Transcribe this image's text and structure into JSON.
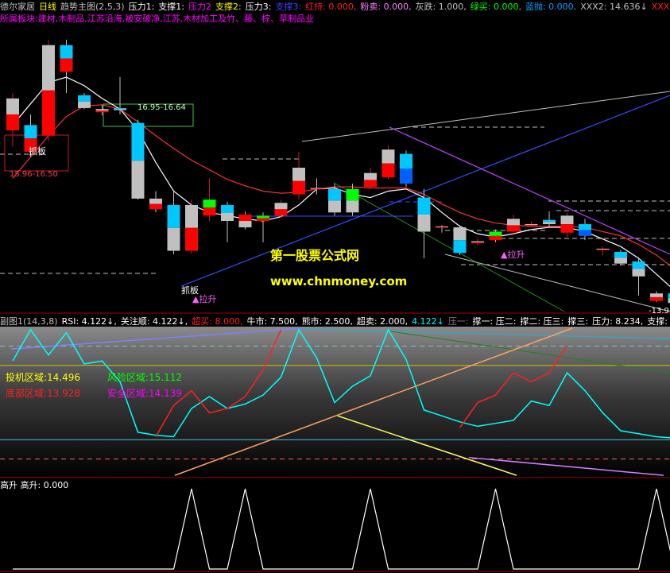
{
  "header_main": [
    {
      "text": "德尔家居",
      "color": "#c0c0c0"
    },
    {
      "text": "日线",
      "color": "#ffff00"
    },
    {
      "text": "趋势主图(2,5,3)",
      "color": "#c0c0c0"
    },
    {
      "text": "压力1:",
      "color": "#ffffff"
    },
    {
      "text": "支撑1:",
      "color": "#ffffff"
    },
    {
      "text": "压力2",
      "color": "#ff00ff"
    },
    {
      "text": "支撑2:",
      "color": "#ffff00"
    },
    {
      "text": "压力3:",
      "color": "#ffffff"
    },
    {
      "text": "支撑3:",
      "color": "#4040ff"
    },
    {
      "text": "红持: 0.000,",
      "color": "#ff2020"
    },
    {
      "text": "粉卖: 0.000,",
      "color": "#ff80ff"
    },
    {
      "text": "灰跌: 1.000,",
      "color": "#c0c0c0"
    },
    {
      "text": "绿买: 0.000,",
      "color": "#00ff00"
    },
    {
      "text": "蓝抛: 0.000,",
      "color": "#00a0ff"
    },
    {
      "text": "XXX2: 14.636↓",
      "color": "#c0c0c0"
    },
    {
      "text": "XXX3: 14.595↑",
      "color": "#ff2020"
    }
  ],
  "sector_line": {
    "text": "所属板块:建材,木制品,江苏沿海,被安破净,江苏,木材加工及竹、藤、棕、草制品业",
    "color": "#ff00ff"
  },
  "header_sub": [
    {
      "text": "副图1(14,3,8)",
      "color": "#c0c0c0"
    },
    {
      "text": "RSI: 4.122↓,",
      "color": "#ffffff"
    },
    {
      "text": "关注顺: 4.122↓,",
      "color": "#ffffff"
    },
    {
      "text": "超买: 8.000,",
      "color": "#ff2020"
    },
    {
      "text": "牛市: 7.500,",
      "color": "#ffffff"
    },
    {
      "text": "熊市: 2.500,",
      "color": "#ffffff"
    },
    {
      "text": "超卖: 2.000,",
      "color": "#ffffff"
    },
    {
      "text": "4.122↓",
      "color": "#00ffff"
    },
    {
      "text": "压一:",
      "color": "#808080"
    },
    {
      "text": "撑一: 压二:",
      "color": "#ffffff"
    },
    {
      "text": "撑二: 压三:",
      "color": "#ffffff"
    },
    {
      "text": "撑三:",
      "color": "#ffffff"
    },
    {
      "text": "压力: 8.234,",
      "color": "#ffffff"
    },
    {
      "text": "支撑: 0.564,",
      "color": "#ffffff"
    },
    {
      "text": "4.122↓",
      "color": "#ffffff"
    }
  ],
  "header_sub2": {
    "text": "高升 高升: 0.000",
    "color": "#ffffff"
  },
  "box_label": "16.95-16.64",
  "box_label2": "15.96-16.50",
  "left_box_label": "抓板",
  "zhuaban_label": "抓板",
  "lasheng_labels": [
    "▲拉升",
    "▲拉升"
  ],
  "price_tag": "-13.9",
  "watermark": {
    "line1": "第一股票公式网",
    "line2": "www.chnmoney.com"
  },
  "zones": {
    "invest": {
      "label": "投机区域:",
      "value": "14.496",
      "color": "#ffff00"
    },
    "risk": {
      "label": "风险区域:",
      "value": "15.112",
      "color": "#00ff00"
    },
    "bottom": {
      "label": "底部区域:",
      "value": "13.928",
      "color": "#ff2020"
    },
    "safe": {
      "label": "安全区域:",
      "value": "14.139",
      "color": "#ff00ff"
    }
  },
  "chart_data": [
    {
      "type": "candlestick",
      "title": "德尔家居 日线",
      "candles": [
        {
          "o": 16.75,
          "c": 17.05,
          "h": 17.1,
          "l": 16.6,
          "dir": "up",
          "colors": [
            "#c0c0c0",
            "#ff0000"
          ]
        },
        {
          "o": 16.8,
          "c": 16.55,
          "h": 16.9,
          "l": 16.5,
          "dir": "down",
          "colors": [
            "#00c8ff",
            "#ff0000"
          ]
        },
        {
          "o": 16.7,
          "c": 17.55,
          "h": 17.6,
          "l": 16.65,
          "dir": "up",
          "colors": [
            "#c0c0c0",
            "#ff0000"
          ]
        },
        {
          "o": 17.55,
          "c": 17.3,
          "h": 17.6,
          "l": 17.1,
          "dir": "down",
          "colors": [
            "#00c8ff",
            "#ff0000"
          ]
        },
        {
          "o": 17.08,
          "c": 16.96,
          "h": 17.1,
          "l": 16.95,
          "dir": "down",
          "colors": [
            "#00c8ff",
            "#c0c0c0"
          ]
        },
        {
          "o": 16.95,
          "c": 16.92,
          "h": 16.99,
          "l": 16.89,
          "dir": "down",
          "colors": [
            "#c0c0c0",
            "#ff0000"
          ]
        },
        {
          "o": 16.96,
          "c": 16.94,
          "h": 17.25,
          "l": 16.9,
          "dir": "down",
          "colors": [
            "#00c8ff",
            "#c0c0c0"
          ]
        },
        {
          "o": 16.82,
          "c": 16.11,
          "h": 16.85,
          "l": 16.1,
          "dir": "down",
          "colors": [
            "#00c8ff",
            "#c0c0c0"
          ]
        },
        {
          "o": 16.11,
          "c": 16.01,
          "h": 16.18,
          "l": 15.98,
          "dir": "down",
          "colors": [
            "#c0c0c0",
            "#ff0000"
          ]
        },
        {
          "o": 16.05,
          "c": 15.62,
          "h": 16.18,
          "l": 15.59,
          "dir": "down",
          "colors": [
            "#00c8ff",
            "#c0c0c0"
          ]
        },
        {
          "o": 15.62,
          "c": 16.05,
          "h": 16.1,
          "l": 15.59,
          "dir": "up",
          "colors": [
            "#c0c0c0",
            "#ff0000"
          ]
        },
        {
          "o": 15.95,
          "c": 16.1,
          "h": 16.3,
          "l": 15.9,
          "dir": "up",
          "colors": [
            "#00ff00",
            "#ff0000"
          ]
        },
        {
          "o": 16.05,
          "c": 15.9,
          "h": 16.08,
          "l": 15.7,
          "dir": "down",
          "colors": [
            "#00c8ff",
            "#c0c0c0"
          ]
        },
        {
          "o": 15.96,
          "c": 15.84,
          "h": 15.99,
          "l": 15.82,
          "dir": "down",
          "colors": [
            "#ff0000",
            "#c0c0c0"
          ]
        },
        {
          "o": 15.95,
          "c": 15.9,
          "h": 15.98,
          "l": 15.7,
          "dir": "down",
          "colors": [
            "#00ff00",
            "#ff0000"
          ]
        },
        {
          "o": 15.95,
          "c": 16.07,
          "h": 16.1,
          "l": 15.93,
          "dir": "up",
          "colors": [
            "#c0c0c0",
            "#ff0000"
          ]
        },
        {
          "o": 16.15,
          "c": 16.4,
          "h": 16.55,
          "l": 16.1,
          "dir": "up",
          "colors": [
            "#c0c0c0",
            "#ff0000"
          ]
        },
        {
          "o": 16.21,
          "c": 16.2,
          "h": 16.3,
          "l": 16.15,
          "dir": "down",
          "colors": [
            "#c0c0c0",
            "#ff0000"
          ]
        },
        {
          "o": 16.2,
          "c": 15.98,
          "h": 16.25,
          "l": 15.95,
          "dir": "down",
          "colors": [
            "#00c8ff",
            "#c0c0c0"
          ]
        },
        {
          "o": 16.2,
          "c": 15.98,
          "h": 16.25,
          "l": 15.95,
          "dir": "down",
          "colors": [
            "#00ff00",
            "#c0c0c0"
          ]
        },
        {
          "o": 16.22,
          "c": 16.35,
          "h": 16.4,
          "l": 16.2,
          "dir": "up",
          "colors": [
            "#c0c0c0",
            "#ff0000"
          ]
        },
        {
          "o": 16.31,
          "c": 16.57,
          "h": 16.61,
          "l": 16.29,
          "dir": "up",
          "colors": [
            "#c0c0c0",
            "#ff0000"
          ]
        },
        {
          "o": 16.53,
          "c": 16.25,
          "h": 16.56,
          "l": 16.22,
          "dir": "down",
          "colors": [
            "#00c8ff",
            "#0060ff"
          ]
        },
        {
          "o": 16.12,
          "c": 15.8,
          "h": 16.2,
          "l": 15.55,
          "dir": "down",
          "colors": [
            "#00c8ff",
            "#c0c0c0"
          ]
        },
        {
          "o": 15.85,
          "c": 15.84,
          "h": 15.86,
          "l": 15.79,
          "dir": "down",
          "colors": [
            "#c0c0c0",
            "#ff0000"
          ]
        },
        {
          "o": 15.84,
          "c": 15.6,
          "h": 15.86,
          "l": 15.58,
          "dir": "down",
          "colors": [
            "#c0c0c0",
            "#00c8ff"
          ]
        },
        {
          "o": 15.69,
          "c": 15.71,
          "h": 15.74,
          "l": 15.67,
          "dir": "up",
          "colors": [
            "#c0c0c0",
            "#ff0000"
          ]
        },
        {
          "o": 15.8,
          "c": 15.72,
          "h": 15.82,
          "l": 15.7,
          "dir": "down",
          "colors": [
            "#00ff00",
            "#ff0000"
          ]
        },
        {
          "o": 15.8,
          "c": 15.92,
          "h": 15.96,
          "l": 15.78,
          "dir": "up",
          "colors": [
            "#c0c0c0",
            "#ff0000"
          ]
        },
        {
          "o": 15.86,
          "c": 15.87,
          "h": 15.9,
          "l": 15.84,
          "dir": "up",
          "colors": [
            "#c0c0c0",
            "#ff0000"
          ]
        },
        {
          "o": 15.91,
          "c": 15.87,
          "h": 15.99,
          "l": 15.84,
          "dir": "down",
          "colors": [
            "#00c8ff",
            "#c0c0c0"
          ]
        },
        {
          "o": 15.79,
          "c": 15.95,
          "h": 15.98,
          "l": 15.75,
          "dir": "up",
          "colors": [
            "#c0c0c0",
            "#ff0000"
          ]
        },
        {
          "o": 15.87,
          "c": 15.76,
          "h": 15.92,
          "l": 15.72,
          "dir": "down",
          "colors": [
            "#00c8ff",
            "#0060ff"
          ]
        },
        {
          "o": 15.63,
          "c": 15.64,
          "h": 15.66,
          "l": 15.58,
          "dir": "up",
          "colors": [
            "#c0c0c0",
            "#ff0000"
          ]
        },
        {
          "o": 15.61,
          "c": 15.5,
          "h": 15.63,
          "l": 15.48,
          "dir": "down",
          "colors": [
            "#00c8ff",
            "#c0c0c0"
          ]
        },
        {
          "o": 15.52,
          "c": 15.38,
          "h": 15.56,
          "l": 15.2,
          "dir": "down",
          "colors": [
            "#00c8ff",
            "#c0c0c0"
          ]
        },
        {
          "o": 15.22,
          "c": 15.15,
          "h": 15.24,
          "l": 15.14,
          "dir": "down",
          "colors": [
            "#c0c0c0",
            "#ff0000"
          ]
        },
        {
          "o": 15.22,
          "c": 15.13,
          "h": 15.28,
          "l": 15.1,
          "dir": "down",
          "colors": [
            "#00c8ff",
            "#c0c0c0"
          ]
        }
      ],
      "lines": [
        {
          "name": "",
          "color": "#ffffff",
          "values": [
            16.8,
            17.0,
            17.2,
            17.25,
            17.17,
            17.05,
            16.95,
            16.75,
            16.45,
            16.18,
            16.05,
            15.98,
            15.95,
            15.92,
            15.9,
            15.94,
            16.05,
            16.2,
            16.21,
            16.15,
            16.12,
            16.18,
            16.2,
            16.12,
            15.98,
            15.85,
            15.78,
            15.75,
            15.78,
            15.82,
            15.84,
            15.84,
            15.8,
            15.73,
            15.66,
            15.55,
            15.4,
            15.25
          ]
        },
        {
          "name": "",
          "color": "#ff3030",
          "values": [
            16.3,
            16.5,
            16.7,
            16.88,
            16.98,
            16.99,
            16.95,
            16.83,
            16.7,
            16.58,
            16.47,
            16.38,
            16.29,
            16.23,
            16.18,
            16.16,
            16.17,
            16.2,
            16.22,
            16.22,
            16.21,
            16.21,
            16.21,
            16.15,
            16.06,
            15.98,
            15.92,
            15.88,
            15.86,
            15.85,
            15.85,
            15.85,
            15.84,
            15.8,
            15.76,
            15.68,
            15.58,
            15.45
          ]
        }
      ],
      "annotations": [
        "16.95-16.64",
        "15.96-16.50",
        "抓板",
        "▲拉升",
        "-13.9"
      ]
    },
    {
      "type": "line",
      "title": "副图1(14,3,8)",
      "levels": {
        "超买": 8.0,
        "牛市": 7.5,
        "熊市": 2.5,
        "超卖": 2.0
      },
      "ylim": [
        0,
        10
      ],
      "series": [
        {
          "name": "RSI",
          "color": "#00ffff",
          "values": [
            7.8,
            9.9,
            8.2,
            9.7,
            7.6,
            7.8,
            6.4,
            3.0,
            2.8,
            2.7,
            4.6,
            5.4,
            4.6,
            4.9,
            5.5,
            6.7,
            9.9,
            8.0,
            5.0,
            6.1,
            6.8,
            9.9,
            7.9,
            4.5,
            4.1,
            3.7,
            3.4,
            3.6,
            3.8,
            5.1,
            4.8,
            7.0,
            5.8,
            4.3,
            3.1,
            2.9,
            2.7,
            2.6
          ]
        },
        {
          "name": "",
          "color": "#ff2020",
          "values": [
            null,
            null,
            null,
            null,
            null,
            null,
            null,
            null,
            2.7,
            4.8,
            5.8,
            4.3,
            4.6,
            5.4,
            7.2,
            9.9,
            null,
            null,
            null,
            null,
            null,
            null,
            null,
            null,
            null,
            3.3,
            5.0,
            5.5,
            7.0,
            6.4,
            7.0,
            8.8,
            null,
            null,
            null,
            null,
            null,
            null
          ]
        },
        {
          "name": "压力",
          "color": "#ffffff",
          "values": [
            8.234
          ]
        },
        {
          "name": "支撑",
          "color": "#ffffff",
          "values": [
            0.564
          ]
        }
      ]
    },
    {
      "type": "line",
      "title": "高升",
      "ylim": [
        0,
        1
      ],
      "series": [
        {
          "name": "高升",
          "color": "#ffffff",
          "values": [
            0,
            0,
            0,
            0,
            0,
            0,
            0,
            0,
            0,
            0,
            1,
            0,
            0,
            1,
            0,
            0,
            0,
            0,
            0,
            0,
            1,
            0,
            0,
            0,
            0,
            0,
            0,
            1,
            0,
            0,
            0,
            0,
            0,
            0,
            0,
            0,
            1,
            0
          ]
        }
      ]
    }
  ]
}
